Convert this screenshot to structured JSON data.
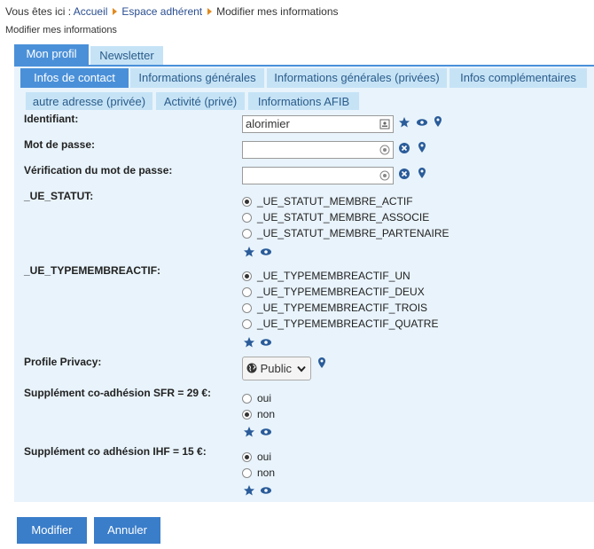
{
  "breadcrumb": {
    "prefix": "Vous êtes ici :",
    "items": [
      "Accueil",
      "Espace adhérent"
    ],
    "current": "Modifier mes informations"
  },
  "page_title": "Modifier mes informations",
  "tabs_level1": [
    {
      "label": "Mon profil",
      "active": true
    },
    {
      "label": "Newsletter",
      "active": false
    }
  ],
  "tabs_level2_row1": [
    {
      "label": "Infos de contact",
      "active": true
    },
    {
      "label": "Informations générales",
      "active": false
    },
    {
      "label": "Informations générales (privées)",
      "active": false
    },
    {
      "label": "Infos complémentaires",
      "active": false
    }
  ],
  "tabs_level2_row2": [
    {
      "label": "autre adresse (privée)",
      "active": false
    },
    {
      "label": "Activité (privé)",
      "active": false
    },
    {
      "label": "Informations AFIB",
      "active": false
    }
  ],
  "form": {
    "identifiant": {
      "label": "Identifiant:",
      "value": "alorimier"
    },
    "password": {
      "label": "Mot de passe:",
      "value": ""
    },
    "password_confirm": {
      "label": "Vérification du mot de passe:",
      "value": ""
    },
    "ue_statut": {
      "label": "_UE_STATUT:",
      "options": [
        "_UE_STATUT_MEMBRE_ACTIF",
        "_UE_STATUT_MEMBRE_ASSOCIE",
        "_UE_STATUT_MEMBRE_PARTENAIRE"
      ],
      "selected": 0
    },
    "ue_typemembre": {
      "label": "_UE_TYPEMEMBREACTIF:",
      "options": [
        "_UE_TYPEMEMBREACTIF_UN",
        "_UE_TYPEMEMBREACTIF_DEUX",
        "_UE_TYPEMEMBREACTIF_TROIS",
        "_UE_TYPEMEMBREACTIF_QUATRE"
      ],
      "selected": 0
    },
    "privacy": {
      "label": "Profile Privacy:",
      "value": "Public"
    },
    "sfr": {
      "label": "Supplément co-adhésion SFR = 29 €:",
      "options": [
        "oui",
        "non"
      ],
      "selected": 1
    },
    "ihf": {
      "label": "Supplément co adhésion IHF = 15 €:",
      "options": [
        "oui",
        "non"
      ],
      "selected": 0
    }
  },
  "buttons": {
    "submit": "Modifier",
    "cancel": "Annuler"
  },
  "colors": {
    "accent": "#4a90d9",
    "tab_inactive": "#c6e3f6",
    "panel": "#e8f3fb",
    "button": "#3a7dc9"
  }
}
